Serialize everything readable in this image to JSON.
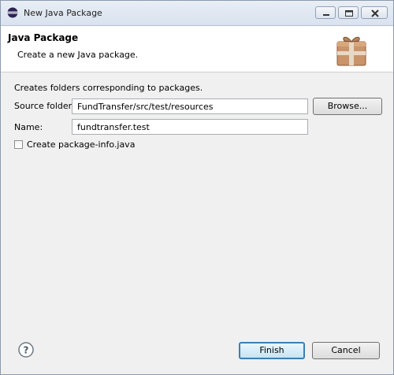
{
  "window": {
    "title": "New Java Package"
  },
  "banner": {
    "title": "Java Package",
    "description": "Create a new Java package."
  },
  "form": {
    "hint": "Creates folders corresponding to packages.",
    "source_folder_label": "Source folder:",
    "source_folder_value": "FundTransfer/src/test/resources",
    "browse_label": "Browse...",
    "name_label": "Name:",
    "name_value": "fundtransfer.test",
    "package_info_label": "Create package-info.java",
    "package_info_checked": false
  },
  "footer": {
    "finish_label": "Finish",
    "cancel_label": "Cancel"
  },
  "icons": {
    "app": "eclipse-icon",
    "banner": "package-icon",
    "help": "help-icon"
  },
  "colors": {
    "accent": "#3c7fb1"
  }
}
